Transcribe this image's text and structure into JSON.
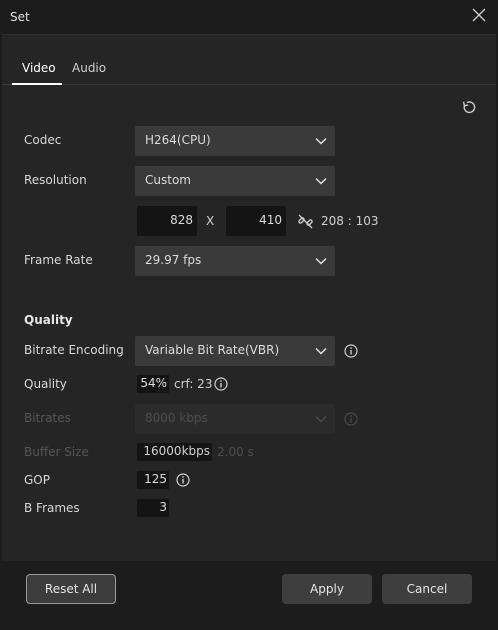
{
  "window": {
    "title": "Set"
  },
  "tabs": [
    {
      "label": "Video"
    },
    {
      "label": "Audio"
    }
  ],
  "video": {
    "codec": {
      "label": "Codec",
      "value": "H264(CPU)"
    },
    "resolution": {
      "label": "Resolution",
      "value": "Custom",
      "width": "828",
      "separator": "X",
      "height": "410",
      "ratio": "208 : 103"
    },
    "frame_rate": {
      "label": "Frame Rate",
      "value": "29.97 fps"
    },
    "quality_section": "Quality",
    "bitrate_encoding": {
      "label": "Bitrate Encoding",
      "value": "Variable Bit Rate(VBR)"
    },
    "quality": {
      "label": "Quality",
      "value": "54%",
      "crf": "crf: 23"
    },
    "bitrates": {
      "label": "Bitrates",
      "value": "8000 kbps"
    },
    "buffer_size": {
      "label": "Buffer Size",
      "value": "16000kbps",
      "seconds": "2.00 s"
    },
    "gop": {
      "label": "GOP",
      "value": "125"
    },
    "b_frames": {
      "label": "B Frames",
      "value": "3"
    }
  },
  "footer": {
    "reset_all": "Reset All",
    "apply": "Apply",
    "cancel": "Cancel"
  },
  "colors": {
    "background": "#1c1c1c",
    "panel": "#252525",
    "select": "#3a3a3a",
    "input": "#141414"
  },
  "icons": [
    "close-icon",
    "reset-icon",
    "chevron-down-icon",
    "unlink-icon",
    "info-icon"
  ]
}
